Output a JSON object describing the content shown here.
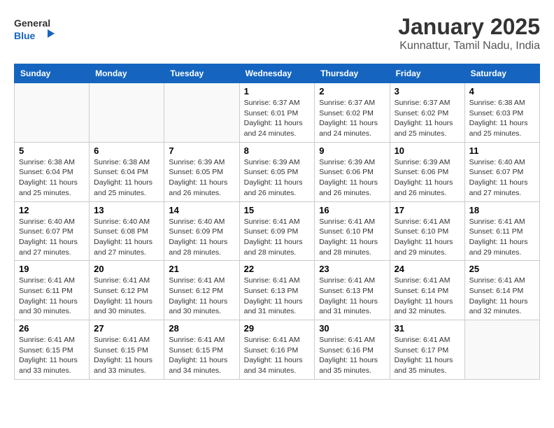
{
  "header": {
    "logo": {
      "general": "General",
      "blue": "Blue"
    },
    "month": "January 2025",
    "location": "Kunnattur, Tamil Nadu, India"
  },
  "weekdays": [
    "Sunday",
    "Monday",
    "Tuesday",
    "Wednesday",
    "Thursday",
    "Friday",
    "Saturday"
  ],
  "weeks": [
    [
      {
        "day": "",
        "info": ""
      },
      {
        "day": "",
        "info": ""
      },
      {
        "day": "",
        "info": ""
      },
      {
        "day": "1",
        "info": "Sunrise: 6:37 AM\nSunset: 6:01 PM\nDaylight: 11 hours and 24 minutes."
      },
      {
        "day": "2",
        "info": "Sunrise: 6:37 AM\nSunset: 6:02 PM\nDaylight: 11 hours and 24 minutes."
      },
      {
        "day": "3",
        "info": "Sunrise: 6:37 AM\nSunset: 6:02 PM\nDaylight: 11 hours and 25 minutes."
      },
      {
        "day": "4",
        "info": "Sunrise: 6:38 AM\nSunset: 6:03 PM\nDaylight: 11 hours and 25 minutes."
      }
    ],
    [
      {
        "day": "5",
        "info": "Sunrise: 6:38 AM\nSunset: 6:04 PM\nDaylight: 11 hours and 25 minutes."
      },
      {
        "day": "6",
        "info": "Sunrise: 6:38 AM\nSunset: 6:04 PM\nDaylight: 11 hours and 25 minutes."
      },
      {
        "day": "7",
        "info": "Sunrise: 6:39 AM\nSunset: 6:05 PM\nDaylight: 11 hours and 26 minutes."
      },
      {
        "day": "8",
        "info": "Sunrise: 6:39 AM\nSunset: 6:05 PM\nDaylight: 11 hours and 26 minutes."
      },
      {
        "day": "9",
        "info": "Sunrise: 6:39 AM\nSunset: 6:06 PM\nDaylight: 11 hours and 26 minutes."
      },
      {
        "day": "10",
        "info": "Sunrise: 6:39 AM\nSunset: 6:06 PM\nDaylight: 11 hours and 26 minutes."
      },
      {
        "day": "11",
        "info": "Sunrise: 6:40 AM\nSunset: 6:07 PM\nDaylight: 11 hours and 27 minutes."
      }
    ],
    [
      {
        "day": "12",
        "info": "Sunrise: 6:40 AM\nSunset: 6:07 PM\nDaylight: 11 hours and 27 minutes."
      },
      {
        "day": "13",
        "info": "Sunrise: 6:40 AM\nSunset: 6:08 PM\nDaylight: 11 hours and 27 minutes."
      },
      {
        "day": "14",
        "info": "Sunrise: 6:40 AM\nSunset: 6:09 PM\nDaylight: 11 hours and 28 minutes."
      },
      {
        "day": "15",
        "info": "Sunrise: 6:41 AM\nSunset: 6:09 PM\nDaylight: 11 hours and 28 minutes."
      },
      {
        "day": "16",
        "info": "Sunrise: 6:41 AM\nSunset: 6:10 PM\nDaylight: 11 hours and 28 minutes."
      },
      {
        "day": "17",
        "info": "Sunrise: 6:41 AM\nSunset: 6:10 PM\nDaylight: 11 hours and 29 minutes."
      },
      {
        "day": "18",
        "info": "Sunrise: 6:41 AM\nSunset: 6:11 PM\nDaylight: 11 hours and 29 minutes."
      }
    ],
    [
      {
        "day": "19",
        "info": "Sunrise: 6:41 AM\nSunset: 6:11 PM\nDaylight: 11 hours and 30 minutes."
      },
      {
        "day": "20",
        "info": "Sunrise: 6:41 AM\nSunset: 6:12 PM\nDaylight: 11 hours and 30 minutes."
      },
      {
        "day": "21",
        "info": "Sunrise: 6:41 AM\nSunset: 6:12 PM\nDaylight: 11 hours and 30 minutes."
      },
      {
        "day": "22",
        "info": "Sunrise: 6:41 AM\nSunset: 6:13 PM\nDaylight: 11 hours and 31 minutes."
      },
      {
        "day": "23",
        "info": "Sunrise: 6:41 AM\nSunset: 6:13 PM\nDaylight: 11 hours and 31 minutes."
      },
      {
        "day": "24",
        "info": "Sunrise: 6:41 AM\nSunset: 6:14 PM\nDaylight: 11 hours and 32 minutes."
      },
      {
        "day": "25",
        "info": "Sunrise: 6:41 AM\nSunset: 6:14 PM\nDaylight: 11 hours and 32 minutes."
      }
    ],
    [
      {
        "day": "26",
        "info": "Sunrise: 6:41 AM\nSunset: 6:15 PM\nDaylight: 11 hours and 33 minutes."
      },
      {
        "day": "27",
        "info": "Sunrise: 6:41 AM\nSunset: 6:15 PM\nDaylight: 11 hours and 33 minutes."
      },
      {
        "day": "28",
        "info": "Sunrise: 6:41 AM\nSunset: 6:15 PM\nDaylight: 11 hours and 34 minutes."
      },
      {
        "day": "29",
        "info": "Sunrise: 6:41 AM\nSunset: 6:16 PM\nDaylight: 11 hours and 34 minutes."
      },
      {
        "day": "30",
        "info": "Sunrise: 6:41 AM\nSunset: 6:16 PM\nDaylight: 11 hours and 35 minutes."
      },
      {
        "day": "31",
        "info": "Sunrise: 6:41 AM\nSunset: 6:17 PM\nDaylight: 11 hours and 35 minutes."
      },
      {
        "day": "",
        "info": ""
      }
    ]
  ]
}
